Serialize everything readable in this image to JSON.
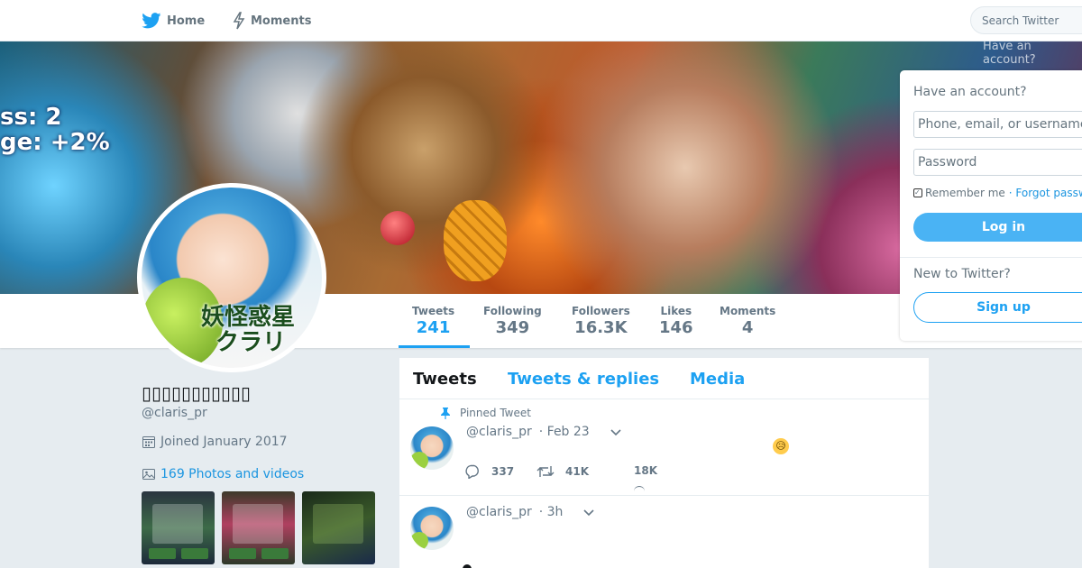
{
  "nav": {
    "home_label": "Home",
    "moments_label": "Moments",
    "search_placeholder": "Search Twitter",
    "ghost_text": "Have an account?"
  },
  "banner": {
    "overlay_text_1": "ss: 2",
    "overlay_text_2": "ge: +2%"
  },
  "avatar": {
    "logo_line1": "妖怪惑星",
    "logo_line2": "クラリ"
  },
  "stats": [
    {
      "label": "Tweets",
      "value": "241"
    },
    {
      "label": "Following",
      "value": "349"
    },
    {
      "label": "Followers",
      "value": "16.3K"
    },
    {
      "label": "Likes",
      "value": "146"
    },
    {
      "label": "Moments",
      "value": "4"
    }
  ],
  "profile": {
    "name": "▯▯▯▯▯▯▯▯▯▯▯",
    "handle": "@claris_pr",
    "joined": "Joined January 2017",
    "photos_link": "169 Photos and videos"
  },
  "timeline": {
    "tabs": [
      {
        "label": "Tweets",
        "active": true
      },
      {
        "label": "Tweets & replies",
        "active": false
      },
      {
        "label": "Media",
        "active": false
      }
    ],
    "tweets": [
      {
        "pinned_label": "Pinned Tweet",
        "handle": "@claris_pr",
        "time": "· Feb 23",
        "emoji": "😥",
        "replies": "337",
        "retweets": "41K",
        "likes": "18K"
      },
      {
        "handle": "@claris_pr",
        "time": "· 3h"
      }
    ]
  },
  "login": {
    "title": "Have an account?",
    "username_placeholder": "Phone, email, or username",
    "password_placeholder": "Password",
    "remember_label": "Remember me",
    "forgot_label": "· Forgot password?",
    "login_button": "Log in",
    "new_label": "New to Twitter?",
    "signup_button": "Sign up"
  },
  "colors": {
    "accent": "#1da1f2",
    "button": "#4ab3f4",
    "background": "#e6ecf0"
  }
}
